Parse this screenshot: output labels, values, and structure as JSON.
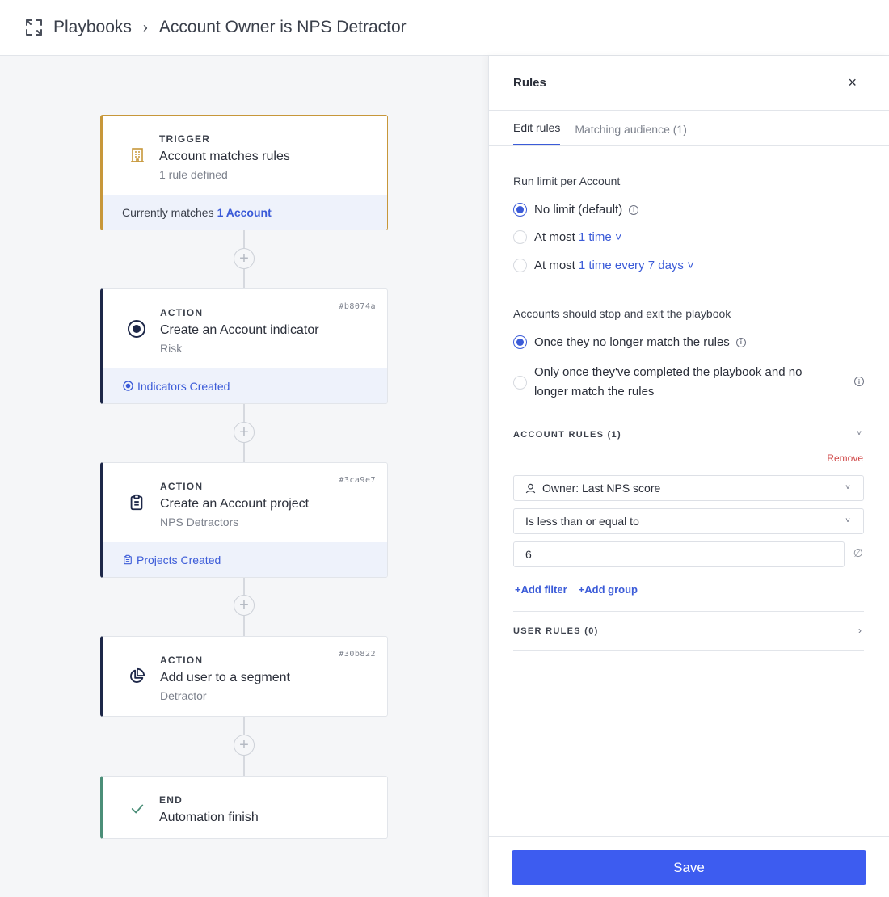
{
  "header": {
    "breadcrumb_root": "Playbooks",
    "breadcrumb_sep": "›",
    "breadcrumb_current": "Account Owner is NPS Detractor"
  },
  "flow": {
    "trigger": {
      "kind": "TRIGGER",
      "title": "Account matches rules",
      "sub": "1 rule defined",
      "footer_prefix": "Currently matches",
      "footer_link": "1 Account"
    },
    "action1": {
      "kind": "ACTION",
      "title": "Create an Account indicator",
      "sub": "Risk",
      "hash": "#b8074a",
      "footer": "Indicators Created"
    },
    "action2": {
      "kind": "ACTION",
      "title": "Create an Account project",
      "sub": "NPS Detractors",
      "hash": "#3ca9e7",
      "footer": "Projects Created"
    },
    "action3": {
      "kind": "ACTION",
      "title": "Add user to a segment",
      "sub": "Detractor",
      "hash": "#30b822"
    },
    "end": {
      "kind": "END",
      "title": "Automation finish"
    },
    "plus_label": "+"
  },
  "panel": {
    "title": "Rules",
    "close": "×",
    "tabs": [
      {
        "label": "Edit rules",
        "active": true
      },
      {
        "label": "Matching audience (1)",
        "active": false
      }
    ],
    "run_limit": {
      "label": "Run limit per Account",
      "options": [
        {
          "text": "No limit (default)",
          "link": "",
          "selected": true,
          "info": true
        },
        {
          "text": "At most",
          "link": "1 time ˅",
          "selected": false,
          "info": false
        },
        {
          "text": "At most",
          "link": "1 time every 7 days ˅",
          "selected": false,
          "info": false
        }
      ]
    },
    "exit": {
      "label": "Accounts should stop and exit the playbook",
      "option1": "Once they no longer match the rules",
      "option2_line1": "Only once they've completed the playbook and no",
      "option2_line2": "longer match the rules"
    },
    "account_rules": {
      "heading": "ACCOUNT RULES (1)",
      "remove": "Remove",
      "field": "Owner: Last NPS score",
      "operator": "Is less than or equal to",
      "value": "6",
      "add_filter": "+Add filter",
      "add_group": "+Add group"
    },
    "user_rules": {
      "heading": "USER RULES (0)"
    },
    "save": "Save"
  }
}
